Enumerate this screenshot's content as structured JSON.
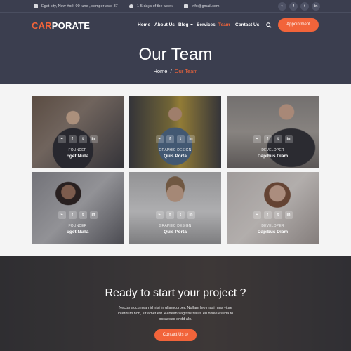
{
  "topbar": {
    "address": "Eget city, New York 00 june , semper awe 87",
    "hours": "1-5 days of the week",
    "email": "info@gmail.com",
    "social": [
      "rss",
      "f",
      "t",
      "in"
    ]
  },
  "brand": {
    "accent": "CAR",
    "rest": "PORATE"
  },
  "nav": {
    "items": [
      "Home",
      "About Us",
      "Blog",
      "Services",
      "Team",
      "Contact Us"
    ],
    "active": "Team",
    "appointment": "Appointment"
  },
  "hero": {
    "title": "Our Team",
    "breadcrumb_home": "Home",
    "breadcrumb_sep": "/",
    "breadcrumb_current": "Our Team"
  },
  "team": [
    {
      "role": "FOUNDER",
      "name": "Eget Nulla"
    },
    {
      "role": "GRAPHIC DESIGN",
      "name": "Quis Porta"
    },
    {
      "role": "DEVELOPER",
      "name": "Dapibus Diam"
    },
    {
      "role": "FOUNDER",
      "name": "Eget Nulla"
    },
    {
      "role": "GRAPHIC DESIGN",
      "name": "Quis Porta"
    },
    {
      "role": "DEVELOPER",
      "name": "Dapibus Diam"
    }
  ],
  "card_icons": [
    "rss",
    "f",
    "t",
    "in"
  ],
  "cta": {
    "title": "Ready to start your project ?",
    "text": "Nectar accumsan id nisi in ullamcorper. Nullam leo masi mus vitae interdum non, sit amet est. Aenean sagit tis tellus eu nisee eseda to occaecas endd alo.",
    "button": "Contact Us"
  },
  "colors": {
    "accent": "#f2643a",
    "header_bg": "#3b3e4f"
  }
}
